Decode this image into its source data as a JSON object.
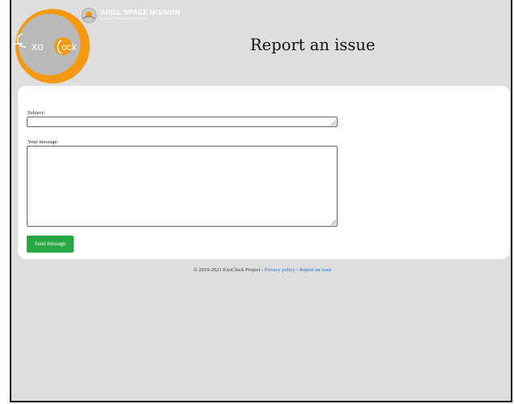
{
  "header": {
    "logo_text_left": "xo",
    "logo_text_right": "ock",
    "partner_title": "ARIEL SPACE MISSION",
    "partner_subtitle": "European Space Agency M4 Mission",
    "page_title": "Report an issue"
  },
  "form": {
    "subject_label": "Subject:",
    "subject_value": "",
    "message_label": "Your message:",
    "message_value": "",
    "send_label": "Send message"
  },
  "footer": {
    "copyright": "© 2019-2021 ExoClock Project - ",
    "privacy_link": "Privacy policy",
    "separator": " - ",
    "report_link": "Report an issue"
  },
  "colors": {
    "page_bg": "#dedede",
    "card_bg": "#ffffff",
    "button_green": "#28a745",
    "link_blue": "#1f6fe0",
    "logo_orange": "#f39a12"
  }
}
